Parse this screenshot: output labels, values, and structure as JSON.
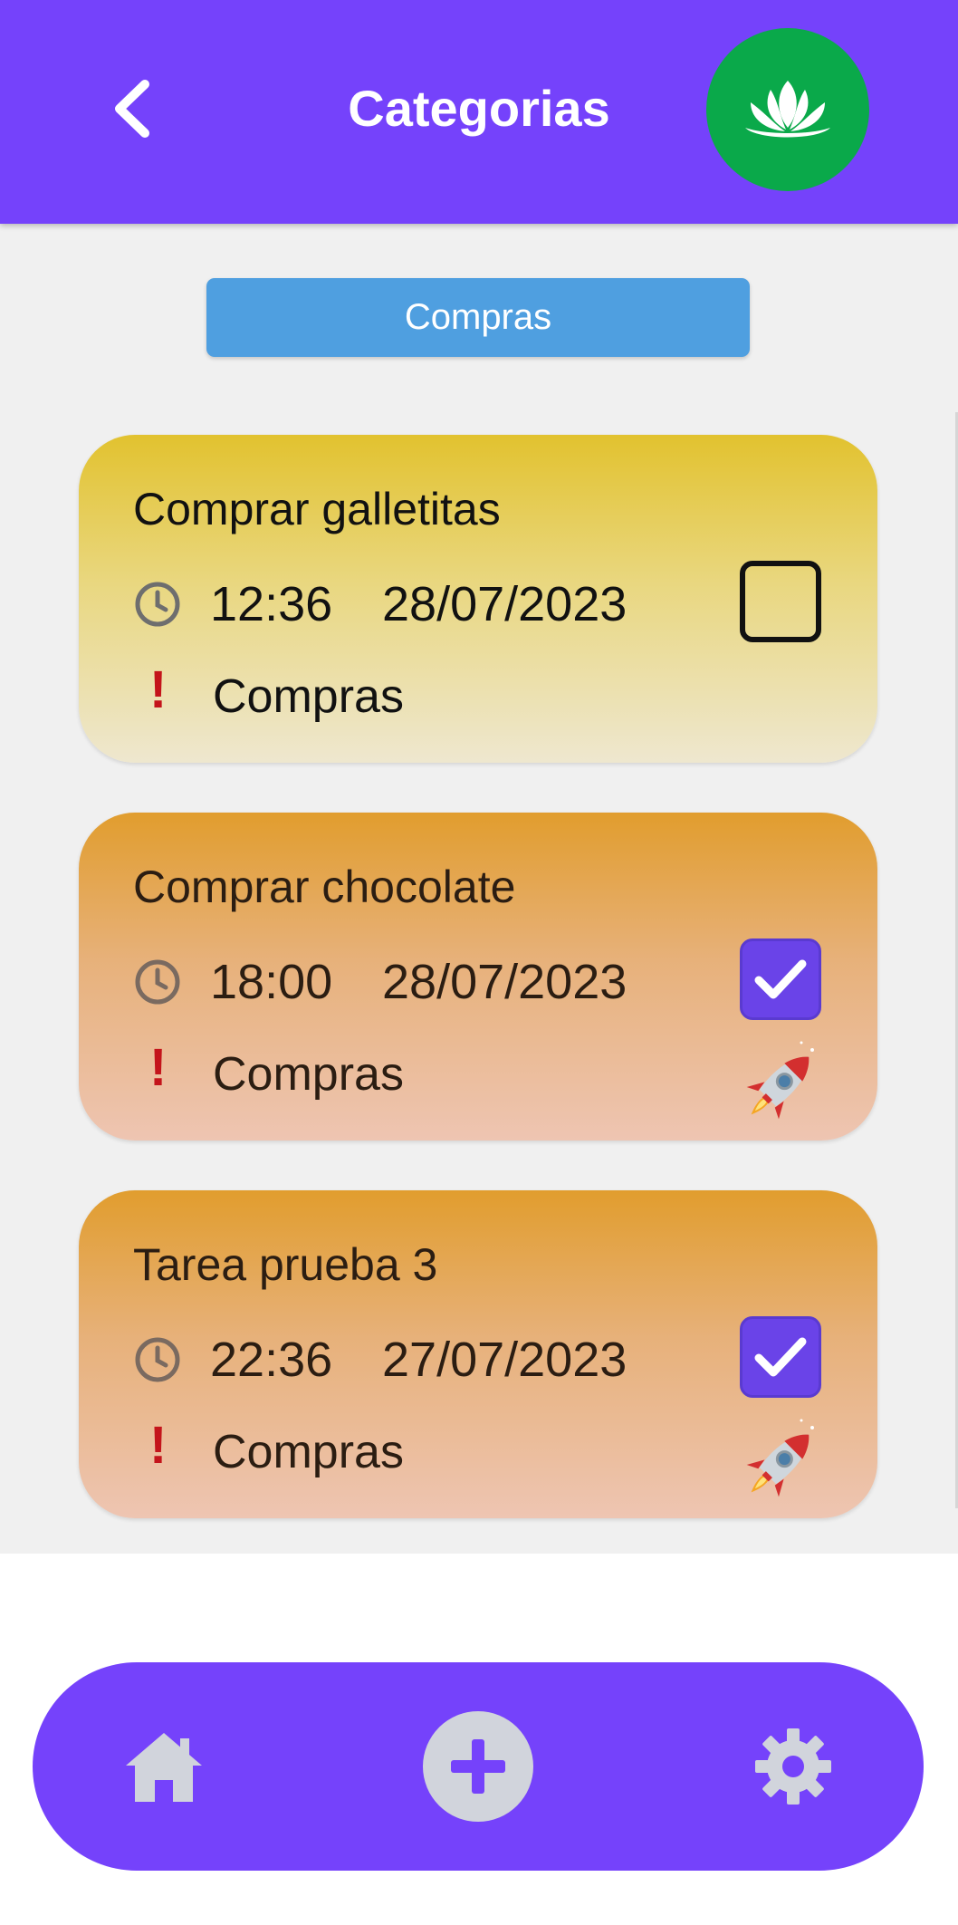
{
  "header": {
    "title": "Categorias",
    "back_icon": "chevron-left-icon",
    "logo_icon": "lotus-icon",
    "background": "#7542fb",
    "logo_color": "#0aa94a"
  },
  "category_filter": {
    "label": "Compras",
    "color": "#4f9fe0"
  },
  "tasks": [
    {
      "title": "Comprar galletitas",
      "time": "12:36",
      "date": "28/07/2023",
      "priority_mark": "!",
      "category": "Compras",
      "completed": false,
      "color": "#e2c22f"
    },
    {
      "title": "Comprar chocolate",
      "time": "18:00",
      "date": "28/07/2023",
      "priority_mark": "!",
      "category": "Compras",
      "completed": true,
      "color": "#e19d2e",
      "badge_icon": "rocket-icon"
    },
    {
      "title": "Tarea prueba 3",
      "time": "22:36",
      "date": "27/07/2023",
      "priority_mark": "!",
      "category": "Compras",
      "completed": true,
      "color": "#e19d2e",
      "badge_icon": "rocket-icon"
    }
  ],
  "bottom_nav": {
    "items": [
      "home-icon",
      "add-icon",
      "settings-icon"
    ],
    "background": "#7542fb"
  }
}
